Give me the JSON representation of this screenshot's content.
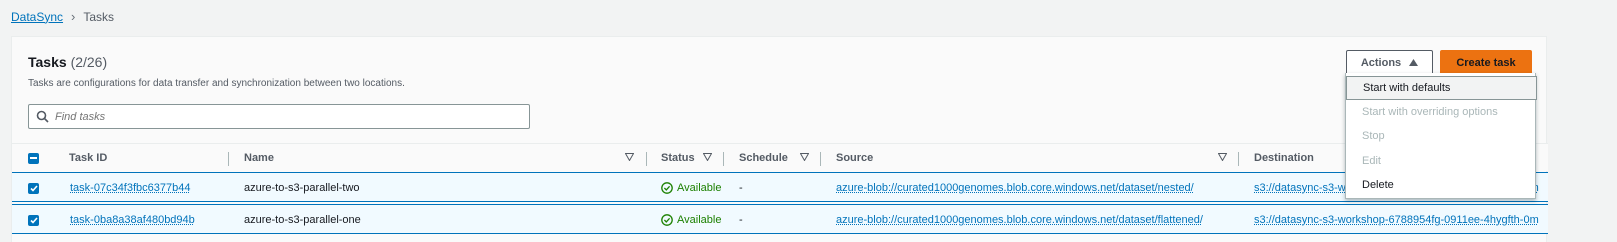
{
  "breadcrumb": {
    "root": "DataSync",
    "current": "Tasks"
  },
  "header": {
    "title": "Tasks",
    "count": "(2/26)",
    "description": "Tasks are configurations for data transfer and synchronization between two locations."
  },
  "search": {
    "placeholder": "Find tasks"
  },
  "toolbar": {
    "actions_label": "Actions",
    "create_label": "Create task"
  },
  "columns": [
    "Task ID",
    "Name",
    "Status",
    "Schedule",
    "Source",
    "Destination"
  ],
  "rows": [
    {
      "task_id": "task-07c34f3fbc6377b44",
      "name": "azure-to-s3-parallel-two",
      "status": "Available",
      "schedule": "-",
      "source": "azure-blob://curated1000genomes.blob.core.windows.net/dataset/nested/",
      "destination": "s3://datasync-s3-workshop-6788954fg-0911ee-4hygfth-0m"
    },
    {
      "task_id": "task-0ba8a38af480bd94b",
      "name": "azure-to-s3-parallel-one",
      "status": "Available",
      "schedule": "-",
      "source": "azure-blob://curated1000genomes.blob.core.windows.net/dataset/flattened/",
      "destination": "s3://datasync-s3-workshop-6788954fg-0911ee-4hygfth-0m"
    }
  ],
  "actions_menu": [
    {
      "label": "Start with defaults",
      "enabled": true
    },
    {
      "label": "Start with overriding options",
      "enabled": false
    },
    {
      "label": "Stop",
      "enabled": false
    },
    {
      "label": "Edit",
      "enabled": false
    },
    {
      "label": "Delete",
      "enabled": true
    }
  ],
  "colors": {
    "link": "#0073bb",
    "primary": "#ec7211",
    "success": "#1d8102",
    "selected_row": "#f1faff"
  }
}
